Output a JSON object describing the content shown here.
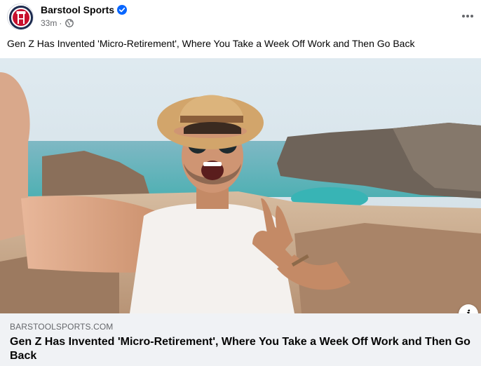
{
  "header": {
    "page_name": "Barstool Sports",
    "timestamp": "33m",
    "separator": "·",
    "verified_icon": "verified-badge-icon",
    "audience_icon": "globe-icon",
    "more_icon": "more-horizontal-icon"
  },
  "post": {
    "text": "Gen Z Has Invented 'Micro-Retirement', Where You Take a Week Off Work and Then Go Back"
  },
  "link_preview": {
    "domain": "BARSTOOLSPORTS.COM",
    "title": "Gen Z Has Invented 'Micro-Retirement', Where You Take a Week Off Work and Then Go Back",
    "info_label": "i"
  },
  "colors": {
    "brand_blue": "#0866ff",
    "barstool_red": "#c8102e",
    "barstool_navy": "#1d2b4f",
    "link_box_bg": "#f0f2f5",
    "secondary_text": "#65676b"
  }
}
